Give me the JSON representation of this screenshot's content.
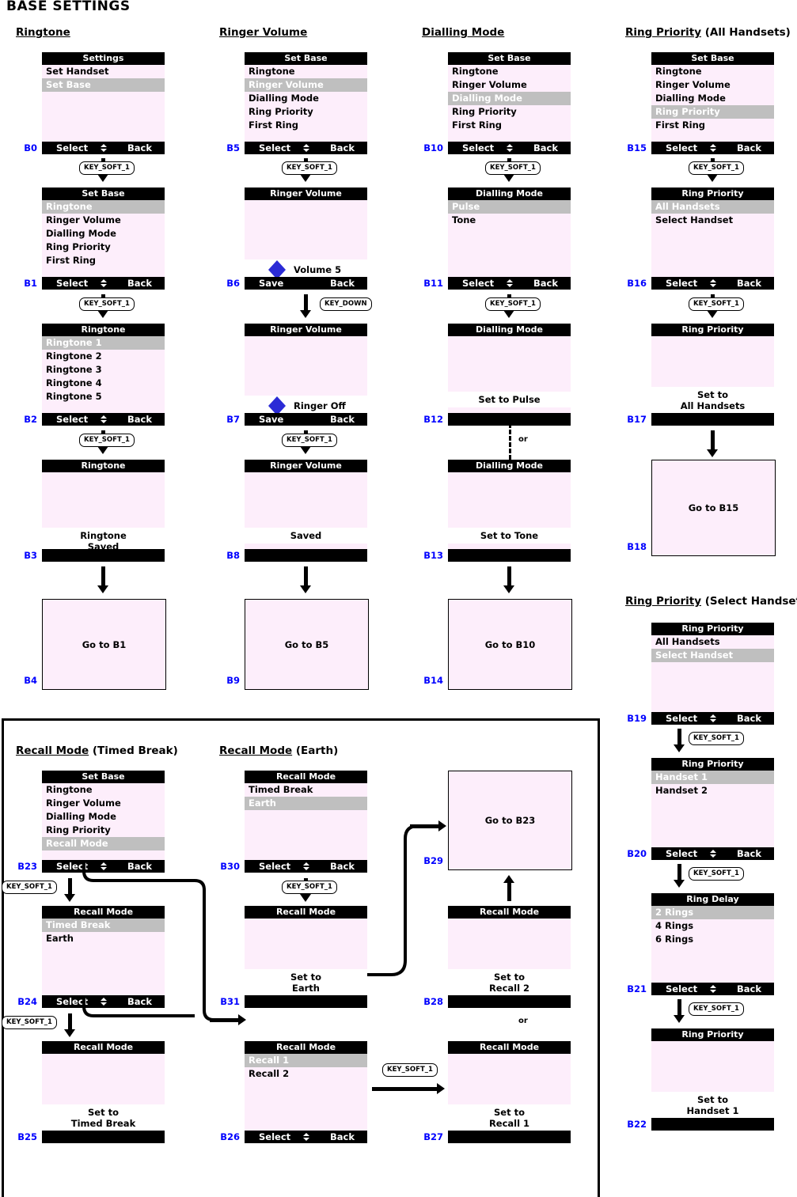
{
  "page": {
    "title": "BASE SETTINGS"
  },
  "sections": [
    {
      "id": "ringtone",
      "underlined": "Ringtone",
      "suffix": ""
    },
    {
      "id": "ringer_volume",
      "underlined": "Ringer Volume",
      "suffix": ""
    },
    {
      "id": "dialling_mode",
      "underlined": "Dialling Mode",
      "suffix": ""
    },
    {
      "id": "ring_priority_all",
      "underlined": "Ring Priority",
      "suffix": " (All Handsets)"
    },
    {
      "id": "ring_priority_sel",
      "underlined": "Ring Priority",
      "suffix": " (Select Handset)"
    },
    {
      "id": "recall_timed",
      "underlined": "Recall Mode",
      "suffix": " (Timed Break)"
    },
    {
      "id": "recall_earth",
      "underlined": "Recall Mode",
      "suffix": " (Earth)"
    }
  ],
  "softkeys": {
    "select": "Select",
    "back": "Back",
    "save": "Save",
    "updown_icon": "up-down-arrow-icon"
  },
  "keys": {
    "soft1": "KEY_SOFT_1",
    "down": "KEY_DOWN"
  },
  "labels": {
    "or": "or"
  },
  "screens": {
    "B0": {
      "id": "B0",
      "title": "Settings",
      "rows": [
        "Set Handset",
        "Set Base"
      ],
      "selected": 1,
      "soft_left": "Select",
      "soft_right": "Back",
      "has_updown": true
    },
    "B1": {
      "id": "B1",
      "title": "Set Base",
      "rows": [
        "Ringtone",
        "Ringer Volume",
        "Dialling Mode",
        "Ring Priority",
        "First Ring"
      ],
      "selected": 0,
      "soft_left": "Select",
      "soft_right": "Back",
      "has_updown": true
    },
    "B2": {
      "id": "B2",
      "title": "Ringtone",
      "rows": [
        "Ringtone 1",
        "Ringtone 2",
        "Ringtone 3",
        "Ringtone 4",
        "Ringtone 5"
      ],
      "selected": 0,
      "soft_left": "Select",
      "soft_right": "Back",
      "has_updown": true
    },
    "B3": {
      "id": "B3",
      "title": "Ringtone",
      "rows": [],
      "message": "Ringtone\nSaved",
      "soft_left": "",
      "soft_right": "",
      "has_updown": false
    },
    "B4": {
      "id": "B4",
      "goto": "Go to B1"
    },
    "B5": {
      "id": "B5",
      "title": "Set Base",
      "rows": [
        "Ringtone",
        "Ringer Volume",
        "Dialling Mode",
        "Ring Priority",
        "First Ring"
      ],
      "selected": 1,
      "soft_left": "Select",
      "soft_right": "Back",
      "has_updown": true
    },
    "B6": {
      "id": "B6",
      "title": "Ringer Volume",
      "rows": [],
      "volume_label": "Volume 5",
      "soft_left": "Save",
      "soft_right": "Back",
      "has_updown": false
    },
    "B7": {
      "id": "B7",
      "title": "Ringer Volume",
      "rows": [],
      "volume_label": "Ringer Off",
      "soft_left": "Save",
      "soft_right": "Back",
      "has_updown": false
    },
    "B8": {
      "id": "B8",
      "title": "Ringer Volume",
      "rows": [],
      "message": "Saved",
      "soft_left": "",
      "soft_right": "",
      "has_updown": false
    },
    "B9": {
      "id": "B9",
      "goto": "Go to B5"
    },
    "B10": {
      "id": "B10",
      "title": "Set Base",
      "rows": [
        "Ringtone",
        "Ringer Volume",
        "Dialling Mode",
        "Ring Priority",
        "First Ring"
      ],
      "selected": 2,
      "soft_left": "Select",
      "soft_right": "Back",
      "has_updown": true
    },
    "B11": {
      "id": "B11",
      "title": "Dialling Mode",
      "rows": [
        "Pulse",
        "Tone"
      ],
      "selected": 0,
      "soft_left": "Select",
      "soft_right": "Back",
      "has_updown": true
    },
    "B12": {
      "id": "B12",
      "title": "Dialling Mode",
      "rows": [],
      "message": "Set to Pulse",
      "soft_left": "",
      "soft_right": "",
      "has_updown": false
    },
    "B13": {
      "id": "B13",
      "title": "Dialling Mode",
      "rows": [],
      "message": "Set to Tone",
      "soft_left": "",
      "soft_right": "",
      "has_updown": false
    },
    "B14": {
      "id": "B14",
      "goto": "Go to B10"
    },
    "B15": {
      "id": "B15",
      "title": "Set Base",
      "rows": [
        "Ringtone",
        "Ringer Volume",
        "Dialling Mode",
        "Ring Priority",
        "First Ring"
      ],
      "selected": 3,
      "soft_left": "Select",
      "soft_right": "Back",
      "has_updown": true
    },
    "B16": {
      "id": "B16",
      "title": "Ring Priority",
      "rows": [
        "All Handsets",
        "Select Handset"
      ],
      "selected": 0,
      "soft_left": "Select",
      "soft_right": "Back",
      "has_updown": true
    },
    "B17": {
      "id": "B17",
      "title": "Ring Priority",
      "rows": [],
      "message": "Set to\nAll Handsets",
      "soft_left": "",
      "soft_right": "",
      "has_updown": false
    },
    "B18": {
      "id": "B18",
      "goto": "Go to B15"
    },
    "B19": {
      "id": "B19",
      "title": "Ring Priority",
      "rows": [
        "All Handsets",
        "Select Handset"
      ],
      "selected": 1,
      "soft_left": "Select",
      "soft_right": "Back",
      "has_updown": true
    },
    "B20": {
      "id": "B20",
      "title": "Ring Priority",
      "rows": [
        "Handset 1",
        "Handset 2"
      ],
      "selected": 0,
      "soft_left": "Select",
      "soft_right": "Back",
      "has_updown": true
    },
    "B21": {
      "id": "B21",
      "title": "Ring Delay",
      "rows": [
        "2 Rings",
        "4 Rings",
        "6 Rings"
      ],
      "selected": 0,
      "soft_left": "Select",
      "soft_right": "Back",
      "has_updown": true
    },
    "B22": {
      "id": "B22",
      "title": "Ring Priority",
      "rows": [],
      "message": "Set to\nHandset 1",
      "soft_left": "",
      "soft_right": "",
      "has_updown": false
    },
    "B23": {
      "id": "B23",
      "title": "Set Base",
      "rows": [
        "Ringtone",
        "Ringer Volume",
        "Dialling Mode",
        "Ring Priority",
        "Recall Mode"
      ],
      "selected": 4,
      "soft_left": "Select",
      "soft_right": "Back",
      "has_updown": true
    },
    "B24": {
      "id": "B24",
      "title": "Recall Mode",
      "rows": [
        "Timed Break",
        "Earth"
      ],
      "selected": 0,
      "soft_left": "Select",
      "soft_right": "Back",
      "has_updown": true
    },
    "B25": {
      "id": "B25",
      "title": "Recall Mode",
      "rows": [],
      "message": "Set to\nTimed Break",
      "soft_left": "",
      "soft_right": "",
      "has_updown": false
    },
    "B26": {
      "id": "B26",
      "title": "Recall Mode",
      "rows": [
        "Recall 1",
        "Recall 2"
      ],
      "selected": 0,
      "soft_left": "Select",
      "soft_right": "Back",
      "has_updown": true
    },
    "B27": {
      "id": "B27",
      "title": "Recall Mode",
      "rows": [],
      "message": "Set to\nRecall 1",
      "soft_left": "",
      "soft_right": "",
      "has_updown": false
    },
    "B28": {
      "id": "B28",
      "title": "Recall Mode",
      "rows": [],
      "message": "Set to\nRecall 2",
      "soft_left": "",
      "soft_right": "",
      "has_updown": false
    },
    "B29": {
      "id": "B29",
      "goto": "Go to B23"
    },
    "B30": {
      "id": "B30",
      "title": "Recall Mode",
      "rows": [
        "Timed Break",
        "Earth"
      ],
      "selected": 1,
      "soft_left": "Select",
      "soft_right": "Back",
      "has_updown": true
    },
    "B31": {
      "id": "B31",
      "title": "Recall Mode",
      "rows": [],
      "message": "Set to\nEarth",
      "soft_left": "",
      "soft_right": "",
      "has_updown": false
    }
  },
  "colors": {
    "screen_bg": "#fdeefb",
    "header_bg": "#000000",
    "highlight_bg": "#bfbfbf",
    "highlight_fg": "#ffffff",
    "node_id": "#0000ff",
    "diamond": "#2b2bd6"
  }
}
